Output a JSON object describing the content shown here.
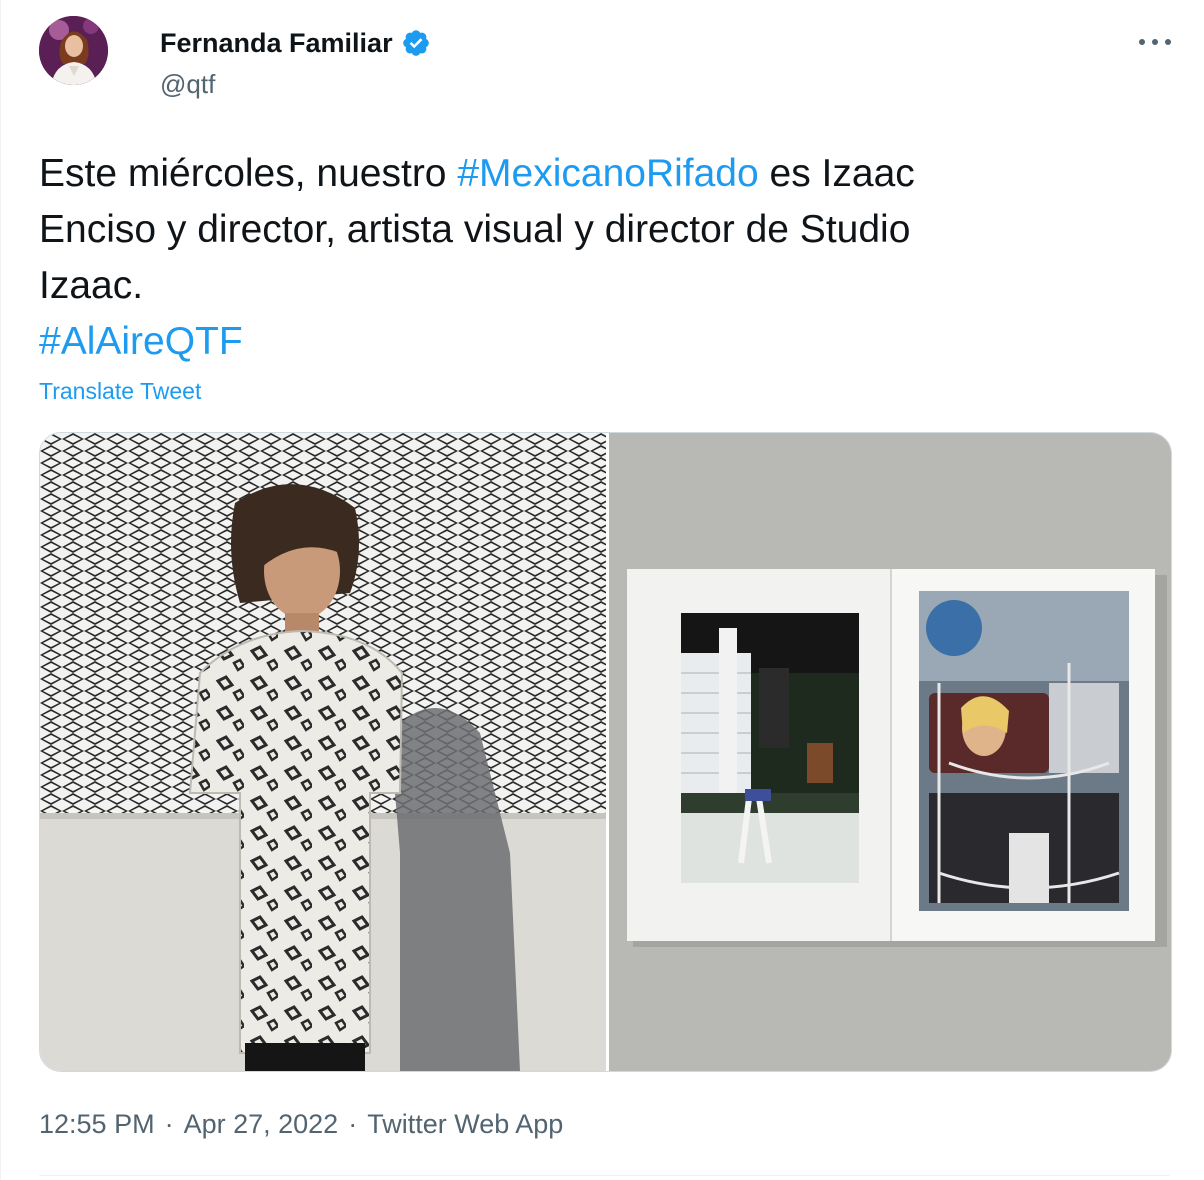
{
  "author": {
    "display_name": "Fernanda Familiar",
    "handle": "@qtf",
    "verified_icon": "verified-badge-icon"
  },
  "more_icon": "more-horizontal-icon",
  "tweet": {
    "line1_prefix": "Este miércoles, nuestro ",
    "hashtag1": "#MexicanoRifado",
    "line1_suffix": " es Izaac",
    "line2": "Enciso y director, artista visual y director de Studio",
    "line3": "Izaac.",
    "hashtag2": "#AlAireQTF"
  },
  "translate_label": "Translate Tweet",
  "footer": {
    "time": "12:55 PM",
    "date": "Apr 27, 2022",
    "source": "Twitter Web App",
    "separator": "·"
  },
  "colors": {
    "link": "#1d9bf0",
    "text": "#0f1419",
    "secondary": "#536471",
    "border": "#cfd9de"
  }
}
